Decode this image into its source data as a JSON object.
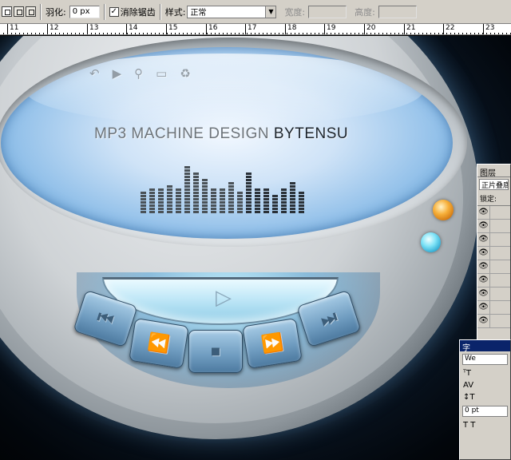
{
  "options_bar": {
    "feather_label": "羽化:",
    "feather_value": "0 px",
    "antialias_checked": "✓",
    "antialias_label": "消除锯齿",
    "style_label": "样式:",
    "style_value": "正常",
    "width_label": "宽度:",
    "height_label": "高度:"
  },
  "ruler": {
    "ticks": [
      "11",
      "12",
      "13",
      "14",
      "15",
      "16",
      "17",
      "18",
      "19",
      "20",
      "21",
      "22",
      "23"
    ]
  },
  "artwork": {
    "screen_title_light": "MP3 MACHINE DESIGN ",
    "screen_title_dark": "BYTENSU",
    "screen_icons": [
      "back-icon",
      "play-icon",
      "wrench-icon",
      "screen-icon",
      "trash-icon"
    ],
    "equalizer_levels": [
      0.45,
      0.55,
      0.5,
      0.6,
      0.55,
      1.0,
      0.85,
      0.7,
      0.5,
      0.55,
      0.65,
      0.45,
      0.85,
      0.55,
      0.5,
      0.4,
      0.55,
      0.65,
      0.45
    ],
    "controls": [
      "prev-icon",
      "rewind-icon",
      "stop-icon",
      "forward-icon",
      "next-icon"
    ]
  },
  "layers_panel": {
    "tab_label": "图层",
    "blend_mode": "正片叠底",
    "lock_label": "锁定:"
  },
  "character_panel": {
    "tab_label": "字",
    "font_value": "We",
    "tracking_value": "0 pt"
  },
  "colors": {
    "screen_blue": "#95c2ea",
    "orange_button": "#f7b03a",
    "cyan_button": "#7fe3f7",
    "ui_gray": "#d4d0c8"
  }
}
